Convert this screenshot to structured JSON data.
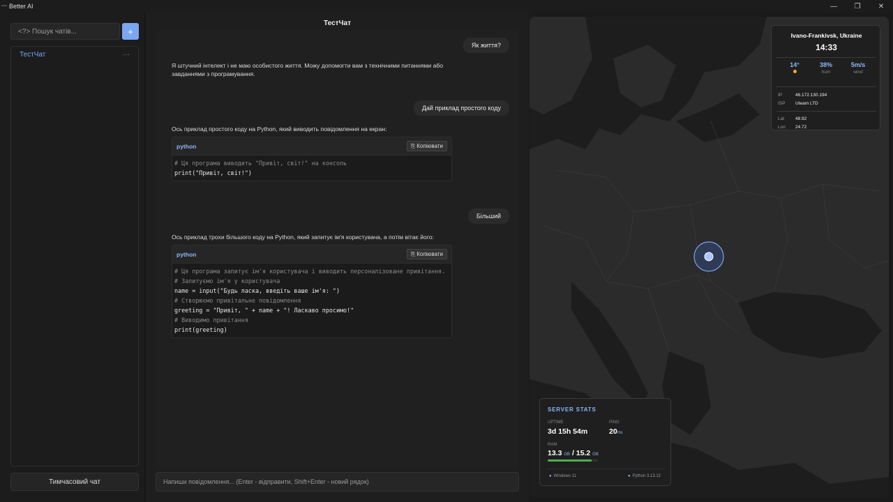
{
  "window": {
    "title": "Better AI",
    "controls": {
      "minimize": "—",
      "maximize": "❐",
      "close": "✕"
    }
  },
  "sidebar": {
    "search_placeholder": "<?> Пошук чатів...",
    "add_label": "+",
    "chats": [
      {
        "label": "ТестЧат",
        "menu": "···"
      }
    ],
    "temp_chat_label": "Тимчасовий чат"
  },
  "chat": {
    "title": "ТестЧат",
    "messages": [
      {
        "role": "user",
        "text": "Як життя?"
      },
      {
        "role": "assistant",
        "text": "Я штучний інтелект і не маю особистого життя. Можу допомогти вам з технічними питаннями або завданнями з програмування."
      },
      {
        "role": "user",
        "text": "Дай приклад простого коду"
      },
      {
        "role": "assistant",
        "text": "Ось приклад простого коду на Python, який виводить повідомлення на екран:"
      },
      {
        "role": "user",
        "text": "Більший"
      },
      {
        "role": "assistant",
        "text": "Ось приклад трохи більшого коду на Python, який запитує ім'я користувача, а потім вітає його:"
      }
    ],
    "code_blocks": [
      {
        "language": "python",
        "copy_label": "Копіювати",
        "lines": [
          "# Ця програма виводить \"Привіт, світ!\" на консоль",
          "print(\"Привіт, світ!\")"
        ]
      },
      {
        "language": "python",
        "copy_label": "Копіювати",
        "lines": [
          "# Ця програма запитує ім'я користувача і виводить персоналізоване привітання.",
          "",
          "# Запитуємо ім'я у користувача",
          "name = input(\"Будь ласка, введіть ваше ім'я: \")",
          "",
          "# Створюємо привітальне повідомлення",
          "greeting = \"Привіт, \" + name + \"! Ласкаво просимо!\"",
          "",
          "# Виводимо привітання",
          "print(greeting)"
        ]
      }
    ],
    "input_placeholder": "Напиши повідомлення... (Enter - відправити, Shift+Enter - новий рядок)"
  },
  "location_card": {
    "city": "Ivano-Frankivsk, Ukraine",
    "time": "14:33",
    "temperature": "14°",
    "humidity": "38%",
    "humidity_label": "hum",
    "wind": "5m/s",
    "wind_label": "wind",
    "ip_label": "IP",
    "ip": "46.172.130.194",
    "isp_label": "ISP",
    "isp": "Uteam LTD",
    "lat_label": "Lat",
    "lat": "48.92",
    "lon_label": "Lon",
    "lon": "24.72"
  },
  "server_stats": {
    "title": "SERVER STATS",
    "uptime_label": "UPTIME",
    "uptime": "3d 15h 54m",
    "ping_label": "PING",
    "ping": "20",
    "ping_unit": "ms",
    "ram_label": "RAM",
    "ram_used": "13.3",
    "ram_total": "15.2",
    "ram_unit": "GB",
    "ram_fraction": 0.875,
    "os": "Windows 11",
    "runtime": "Python 3.13.12"
  },
  "colors": {
    "accent": "#7aa7f0",
    "background": "#1a1a1a",
    "ram_bar": "#4caf50",
    "marker": "#7aa7f0"
  }
}
